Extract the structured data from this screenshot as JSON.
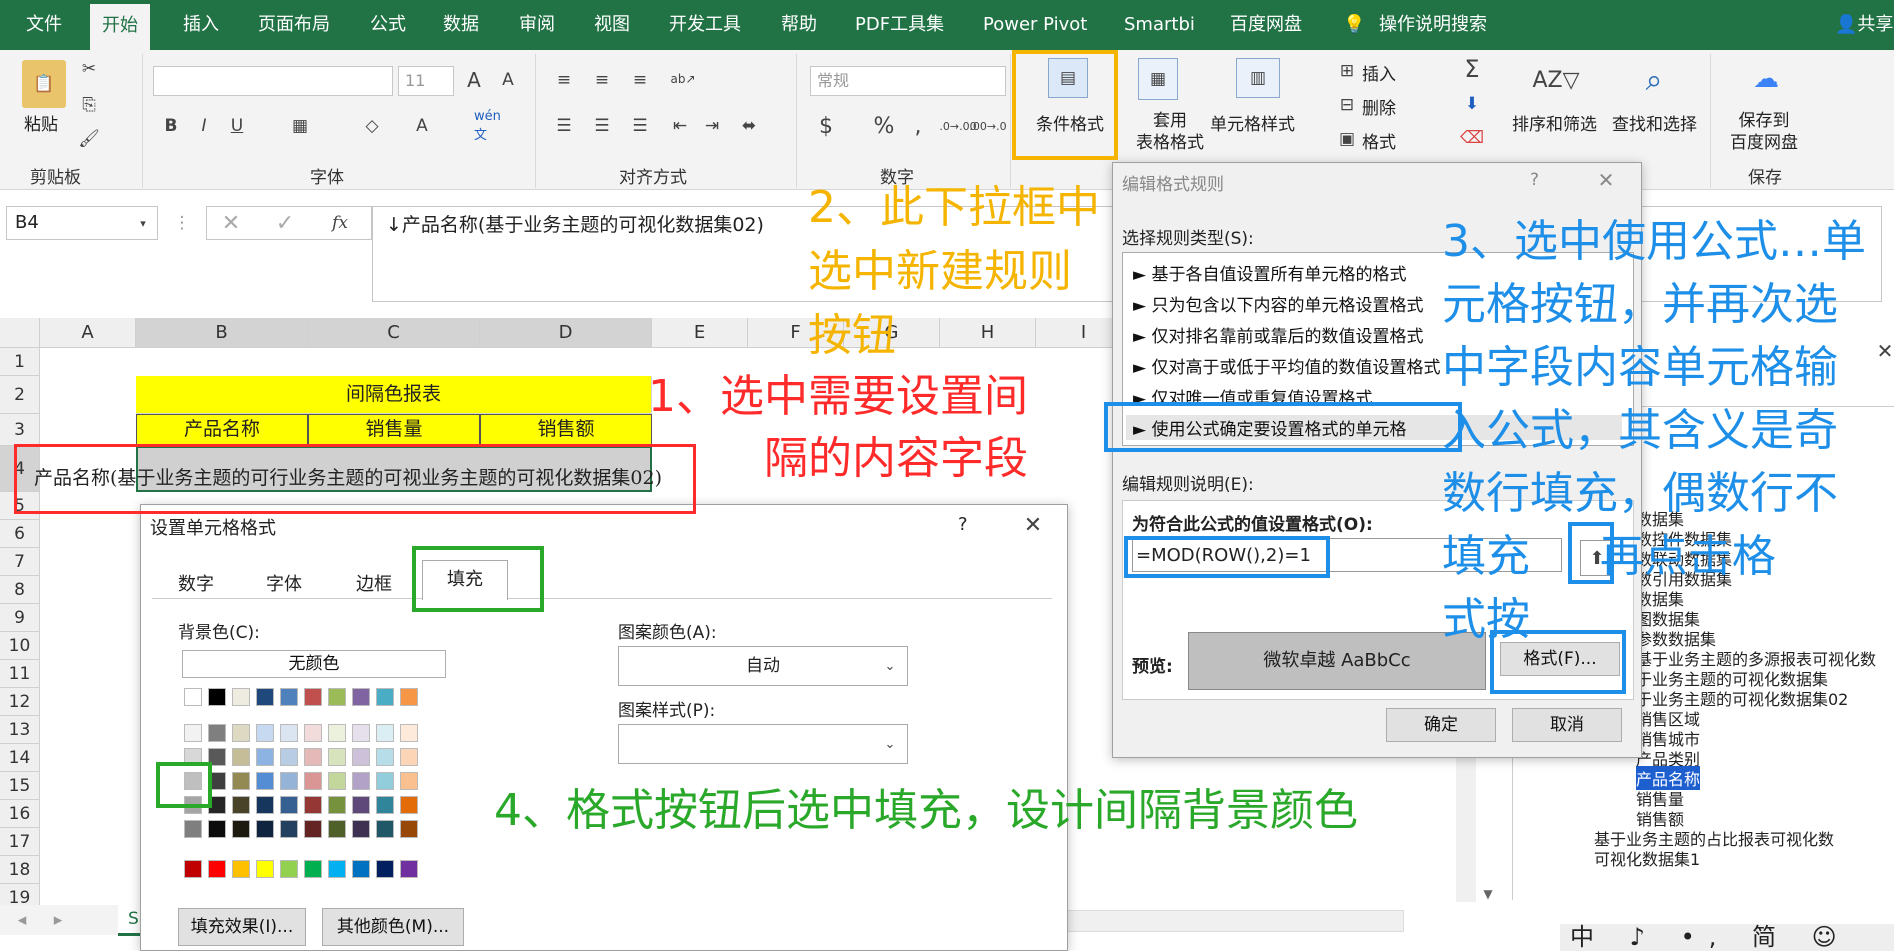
{
  "menu": {
    "tabs": [
      "文件",
      "开始",
      "插入",
      "页面布局",
      "公式",
      "数据",
      "审阅",
      "视图",
      "开发工具",
      "帮助",
      "PDF工具集",
      "Power Pivot",
      "Smartbi",
      "百度网盘",
      "操作说明搜索"
    ],
    "share": "共享"
  },
  "ribbon": {
    "paste": "粘贴",
    "clipboard": "剪贴板",
    "font_size": "11",
    "font_group": "字体",
    "align_group": "对齐方式",
    "number_format": "常规",
    "number_group": "数字",
    "cond_format": "条件格式",
    "table_format": "套用\n表格格式",
    "cell_style": "单元格样式",
    "insert": "插入",
    "delete": "删除",
    "format": "格式",
    "sort_filter": "排序和筛选",
    "find_select": "查找和选择",
    "save_to": "保存到\n百度网盘",
    "save_group": "保存"
  },
  "formula_bar": {
    "name_box": "B4",
    "fx": "fx",
    "formula": "↓产品名称(基于业务主题的可视化数据集02)"
  },
  "sheet": {
    "columns": [
      "A",
      "B",
      "C",
      "D",
      "E",
      "F",
      "G",
      "H",
      "I"
    ],
    "rows": [
      "1",
      "2",
      "3",
      "4",
      "5",
      "6",
      "7",
      "8",
      "9",
      "10",
      "11",
      "12",
      "13",
      "14",
      "15",
      "16",
      "17",
      "18",
      "19"
    ],
    "title": "间隔色报表",
    "headers": [
      "产品名称",
      "销售量",
      "销售额"
    ],
    "row4_text": "产品名称(基于业务主题的可行业务主题的可视业务主题的可视化数据集02)",
    "row4_prefix": "产品名称(基于业务主题的可",
    "row4_b": "行业务主题的可视",
    "row4_c": "业务主题的可视化数据集02)",
    "sheet_tab": "S"
  },
  "rule_dialog": {
    "title": "编辑格式规则",
    "help": "?",
    "select_type_label": "选择规则类型(S):",
    "rule_types": [
      "► 基于各自值设置所有单元格的格式",
      "► 只为包含以下内容的单元格设置格式",
      "► 仅对排名靠前或靠后的数值设置格式",
      "► 仅对高于或低于平均值的数值设置格式",
      "► 仅对唯一值或重复值设置格式",
      "► 使用公式确定要设置格式的单元格"
    ],
    "desc_label": "编辑规则说明(E):",
    "formula_label": "为符合此公式的值设置格式(O):",
    "formula": "=MOD(ROW(),2)=1",
    "preview_label": "预览:",
    "preview_text": "微软卓越  AaBbCc",
    "format_button": "格式(F)...",
    "ok": "确定",
    "cancel": "取消"
  },
  "cell_dialog": {
    "title": "设置单元格格式",
    "help": "?",
    "tabs": [
      "数字",
      "字体",
      "边框",
      "填充"
    ],
    "bg_label": "背景色(C):",
    "no_color": "无颜色",
    "pattern_color_label": "图案颜色(A):",
    "pattern_color": "自动",
    "pattern_style_label": "图案样式(P):",
    "fill_effects": "填充效果(I)...",
    "more_colors": "其他颜色(M)...",
    "palette_row1": [
      "#ffffff",
      "#000000",
      "#eeece1",
      "#1f497d",
      "#4f81bd",
      "#c0504d",
      "#9bbb59",
      "#8064a2",
      "#4bacc6",
      "#f79646"
    ],
    "palette_rows": [
      [
        "#f2f2f2",
        "#7f7f7f",
        "#ddd9c3",
        "#c6d9f0",
        "#dbe5f1",
        "#f2dcdb",
        "#ebf1dd",
        "#e5e0ec",
        "#dbeef3",
        "#fdeada"
      ],
      [
        "#d8d8d8",
        "#595959",
        "#c4bd97",
        "#8db3e2",
        "#b8cce4",
        "#e5b9b7",
        "#d7e3bc",
        "#ccc1d9",
        "#b7dde8",
        "#fbd5b5"
      ],
      [
        "#bfbfbf",
        "#3f3f3f",
        "#938953",
        "#548dd4",
        "#95b3d7",
        "#d99694",
        "#c3d69b",
        "#b2a2c7",
        "#92cddc",
        "#fac08f"
      ],
      [
        "#a5a5a5",
        "#262626",
        "#494429",
        "#17365d",
        "#366092",
        "#953734",
        "#76923c",
        "#5f497a",
        "#31859b",
        "#e36c09"
      ],
      [
        "#7f7f7f",
        "#0c0c0c",
        "#1d1b10",
        "#0f243e",
        "#244061",
        "#632423",
        "#4f6128",
        "#3f3151",
        "#205867",
        "#974806"
      ]
    ],
    "palette_std": [
      "#c00000",
      "#ff0000",
      "#ffc000",
      "#ffff00",
      "#92d050",
      "#00b050",
      "#00b0f0",
      "#0070c0",
      "#002060",
      "#7030a0"
    ]
  },
  "tree": {
    "items": [
      "数据集",
      "数控件数据集",
      "数联动数据集",
      "数引用数据集",
      "数据集",
      "图数据集",
      "参数数据集",
      "基于业务主题的多源报表可视化数",
      "于业务主题的可视化数据集",
      "于业务主题的可视化数据集02",
      "销售区域",
      "销售城市",
      "产品类别",
      "产品名称",
      "销售量",
      "销售额",
      "基于业务主题的占比报表可视化数",
      "可视化数据集1"
    ]
  },
  "annotations": {
    "a1": "1、选中需要设置间\n隔的内容字段",
    "a2": "2、此下拉框中\n选中新建规则\n按钮",
    "a3": "3、选中使用公式…单\n元格按钮，并再次选\n中字段内容单元格输\n入公式，其含义是奇\n数行填充，偶数行不\n填充     再点击格\n式按",
    "a4": "4、格式按钮后选中填充，设计间隔背景颜色",
    "colors": {
      "red": "#ff2b2b",
      "orange": "#f5b400",
      "blue": "#1e8fe8",
      "green": "#2aa82a"
    }
  },
  "ime": "中 ♪ •, 简 ☺ ⚙"
}
